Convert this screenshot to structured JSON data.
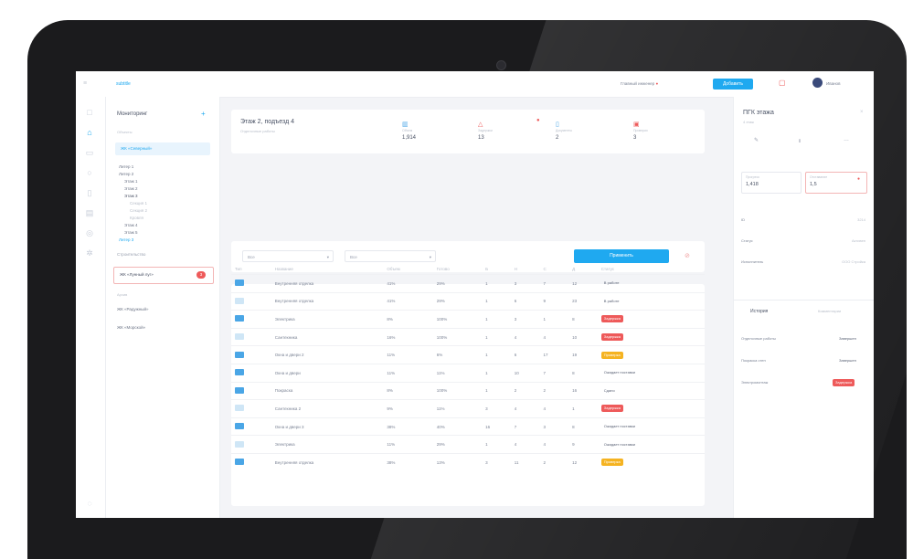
{
  "topbar": {
    "logo": "subtitle",
    "user_status": "Главный инженер",
    "primary_button": "Добавить",
    "user_name": "Иванов"
  },
  "sidebar": {
    "title": "Мониторинг",
    "section_label": "Объекты",
    "selected_item": "ЖК «Северный»",
    "tree": [
      "Литер 1",
      "Литер 2",
      "Этаж 1",
      "Этаж 2",
      "Этаж 3",
      "Секция 1",
      "Секция 2",
      "Кровля",
      "Этаж 4",
      "Этаж 5",
      "Литер 3"
    ],
    "group_label": "Строительство",
    "alert_item": "ЖК «Лунный луг»",
    "alert_count": "3",
    "section2_label": "Архив",
    "archive_items": [
      "ЖК «Радужный»",
      "ЖК «Морской»"
    ]
  },
  "main": {
    "title": "Этаж 2, подъезд 4",
    "subtitle": "Отделочные работы",
    "kpis": [
      {
        "icon": "chart-icon",
        "label": "Объем",
        "value": "1,914",
        "color": "#4aa6e6"
      },
      {
        "icon": "warning-icon",
        "label": "Задержки",
        "value": "13",
        "color": "#ee5a5a"
      },
      {
        "icon": "document-icon",
        "label": "Документы",
        "value": "2",
        "color": "#4aa6e6"
      },
      {
        "icon": "calendar-icon",
        "label": "Проверки",
        "value": "3",
        "color": "#ee5a5a"
      }
    ],
    "filter1": "Все",
    "filter2": "Все",
    "action_button": "Применить",
    "table": {
      "headers": [
        "Тип",
        "Название",
        "Объем",
        "Готово",
        "Б",
        "Н",
        "С",
        "Д",
        "Статус"
      ],
      "rows": [
        {
          "name": "Внутренняя отделка",
          "vol": "41%",
          "done": "29%",
          "b": "1",
          "n": "3",
          "c": "7",
          "d": "12",
          "status": "В работе",
          "kind": "plain",
          "icon": "dark"
        },
        {
          "name": "Внутренняя отделка",
          "vol": "41%",
          "done": "29%",
          "b": "1",
          "n": "6",
          "c": "9",
          "d": "23",
          "status": "В работе",
          "kind": "plain",
          "icon": "light"
        },
        {
          "name": "Электрика",
          "vol": "8%",
          "done": "100%",
          "b": "1",
          "n": "3",
          "c": "1",
          "d": "8",
          "status": "Задержка",
          "kind": "red",
          "icon": "dark"
        },
        {
          "name": "Сантехника",
          "vol": "16%",
          "done": "100%",
          "b": "1",
          "n": "4",
          "c": "4",
          "d": "10",
          "status": "Задержка",
          "kind": "red",
          "icon": "light"
        },
        {
          "name": "Окна и двери 2",
          "vol": "11%",
          "done": "6%",
          "b": "1",
          "n": "6",
          "c": "17",
          "d": "19",
          "status": "Проверка",
          "kind": "yellow",
          "icon": "dark"
        },
        {
          "name": "Окна и двери",
          "vol": "11%",
          "done": "11%",
          "b": "1",
          "n": "10",
          "c": "7",
          "d": "8",
          "status": "Ожидает поставки",
          "kind": "plain",
          "icon": "dark"
        },
        {
          "name": "Покраска",
          "vol": "8%",
          "done": "100%",
          "b": "1",
          "n": "2",
          "c": "2",
          "d": "16",
          "status": "Сдано",
          "kind": "plain",
          "icon": "dark"
        },
        {
          "name": "Сантехника 2",
          "vol": "9%",
          "done": "11%",
          "b": "3",
          "n": "4",
          "c": "4",
          "d": "1",
          "status": "Задержка",
          "kind": "red",
          "icon": "light"
        },
        {
          "name": "Окна и двери 3",
          "vol": "38%",
          "done": "40%",
          "b": "16",
          "n": "7",
          "c": "3",
          "d": "8",
          "status": "Ожидает поставки",
          "kind": "plain",
          "icon": "dark"
        },
        {
          "name": "Электрика",
          "vol": "11%",
          "done": "29%",
          "b": "1",
          "n": "4",
          "c": "4",
          "d": "9",
          "status": "Ожидает поставки",
          "kind": "plain",
          "icon": "light"
        },
        {
          "name": "Внутренняя отделка",
          "vol": "38%",
          "done": "13%",
          "b": "3",
          "n": "11",
          "c": "2",
          "d": "12",
          "status": "Проверка",
          "kind": "yellow",
          "icon": "dark"
        }
      ]
    }
  },
  "right": {
    "title": "ПГК этажа",
    "subtitle": "4 этаж",
    "stat1_label": "Прогресс",
    "stat1_value": "1,418",
    "stat2_label": "Отставание",
    "stat2_value": "1,5",
    "info": [
      {
        "k": "ID",
        "v": "3214"
      },
      {
        "k": "Статус",
        "v": "Активен"
      },
      {
        "k": "Исполнитель",
        "v": "ООО Стройка"
      }
    ],
    "tabs": [
      "История",
      "Комментарии"
    ],
    "history": [
      {
        "k": "Отделочные работы",
        "badge": "Завершен",
        "kind": "plain"
      },
      {
        "k": "Покраска стен",
        "badge": "Завершен",
        "kind": "plain"
      },
      {
        "k": "Электромонтаж",
        "badge": "Задержка",
        "kind": "red"
      }
    ]
  }
}
